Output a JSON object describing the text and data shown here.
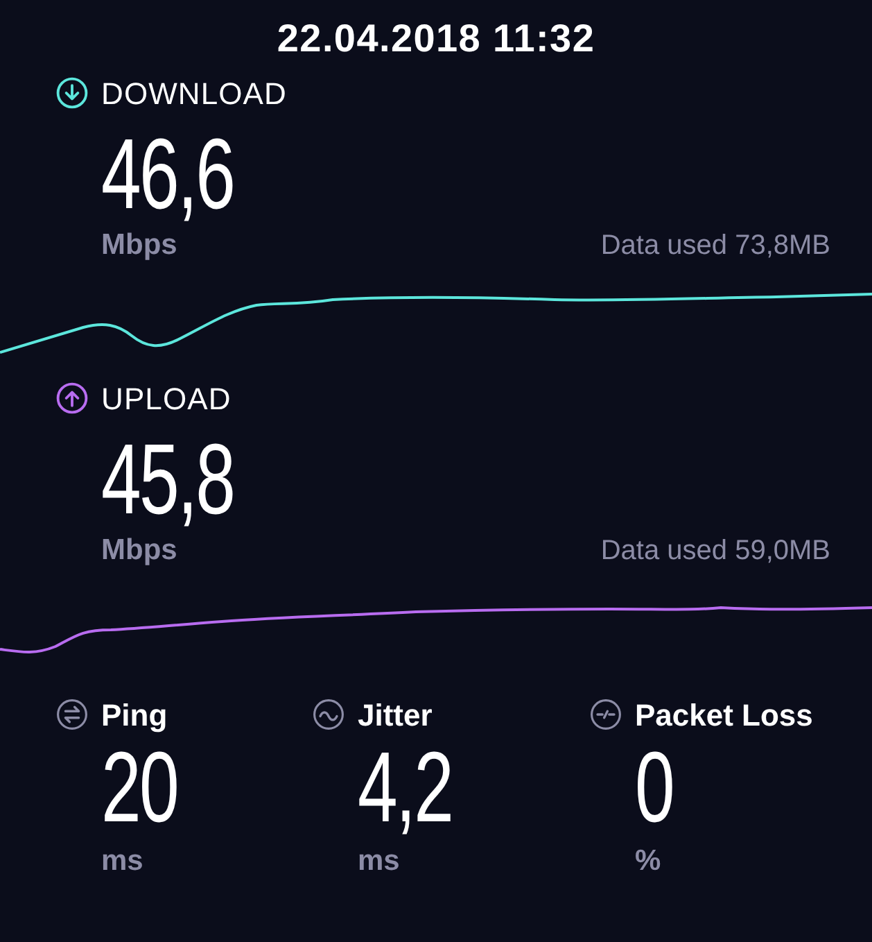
{
  "title": "22.04.2018 11:32",
  "speeds": [
    {
      "kind": "download",
      "label": "DOWNLOAD",
      "value": "46,6",
      "unit": "Mbps",
      "data_used": "Data used 73,8MB",
      "color": "#5ce6dc"
    },
    {
      "kind": "upload",
      "label": "UPLOAD",
      "value": "45,8",
      "unit": "Mbps",
      "data_used": "Data used 59,0MB",
      "color": "#b86cf0"
    }
  ],
  "stats": [
    {
      "kind": "ping",
      "label": "Ping",
      "value": "20",
      "unit": "ms"
    },
    {
      "kind": "jitter",
      "label": "Jitter",
      "value": "4,2",
      "unit": "ms"
    },
    {
      "kind": "packet_loss",
      "label": "Packet Loss",
      "value": "0",
      "unit": "%"
    }
  ]
}
